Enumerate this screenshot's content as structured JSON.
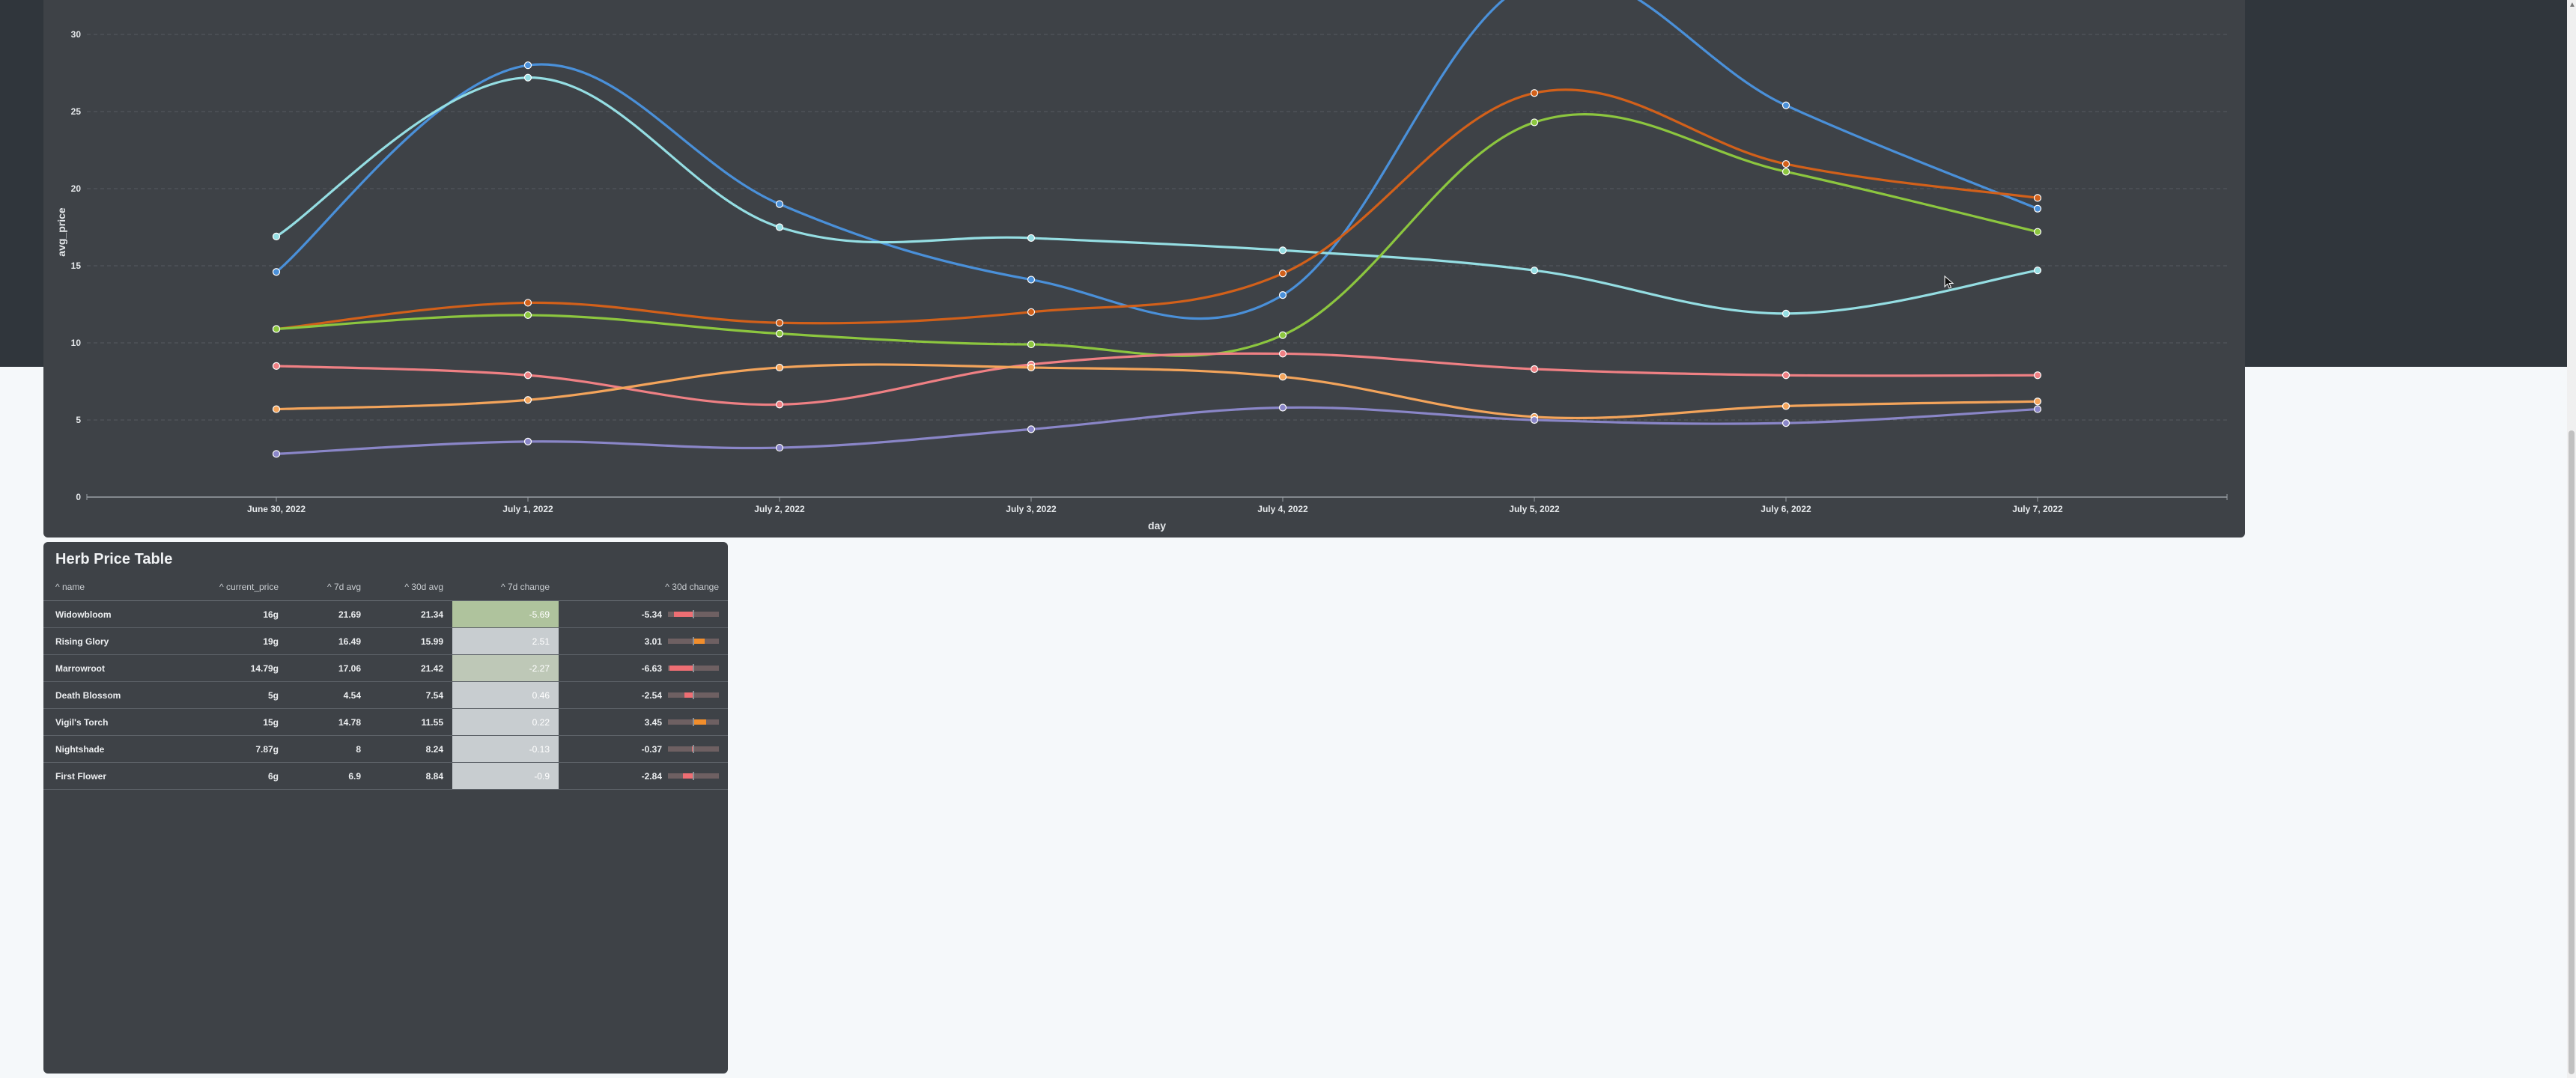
{
  "colors": {
    "background": "#f5f8fa",
    "header_band": "#30363c",
    "panel": "#3e4247",
    "negative_bar": "#ee6e73",
    "positive_bar": "#f28e2c"
  },
  "chart_data": {
    "type": "line",
    "xlabel": "day",
    "ylabel": "avg_price",
    "categories": [
      "June 30, 2022",
      "July 1, 2022",
      "July 2, 2022",
      "July 3, 2022",
      "July 4, 2022",
      "July 5, 2022",
      "July 6, 2022",
      "July 7, 2022"
    ],
    "yticks": [
      "0",
      "5",
      "10",
      "15",
      "20",
      "25",
      "30"
    ],
    "ylim": [
      0,
      30
    ],
    "grid": true,
    "smooth": true,
    "series": [
      {
        "color": "#4a90d9",
        "values": [
          14.6,
          28.0,
          19.0,
          14.1,
          13.1,
          33.5,
          25.4,
          18.7
        ]
      },
      {
        "color": "#95dee3",
        "values": [
          16.9,
          27.2,
          17.5,
          16.8,
          16.0,
          14.7,
          11.9,
          14.7
        ]
      },
      {
        "color": "#d2601a",
        "values": [
          10.9,
          12.6,
          11.3,
          12.0,
          14.5,
          26.2,
          21.6,
          19.4
        ]
      },
      {
        "color": "#8cc63f",
        "values": [
          10.9,
          11.8,
          10.6,
          9.9,
          10.5,
          24.3,
          21.1,
          17.2
        ]
      },
      {
        "color": "#ef8084",
        "values": [
          8.5,
          7.9,
          6.0,
          8.6,
          9.3,
          8.3,
          7.9,
          7.9
        ]
      },
      {
        "color": "#f3a45b",
        "values": [
          5.7,
          6.3,
          8.4,
          8.4,
          7.8,
          5.2,
          5.9,
          6.2
        ]
      },
      {
        "color": "#8a86c8",
        "values": [
          2.8,
          3.6,
          3.2,
          4.4,
          5.8,
          5.0,
          4.8,
          5.7
        ]
      }
    ]
  },
  "table": {
    "title": "Herb Price Table",
    "sort_glyph": "^",
    "columns": [
      "name",
      "current_price",
      "7d avg",
      "30d avg",
      "7d change",
      "30d change"
    ],
    "rows": [
      {
        "name": "Widowbloom",
        "current_price": "16g",
        "avg7": "21.69",
        "avg30": "21.34",
        "chg7": "-5.69",
        "chg30": "-5.34",
        "chg30_value": -5.34
      },
      {
        "name": "Rising Glory",
        "current_price": "19g",
        "avg7": "16.49",
        "avg30": "15.99",
        "chg7": "2.51",
        "chg30": "3.01",
        "chg30_value": 3.01
      },
      {
        "name": "Marrowroot",
        "current_price": "14.79g",
        "avg7": "17.06",
        "avg30": "21.42",
        "chg7": "-2.27",
        "chg30": "-6.63",
        "chg30_value": -6.63
      },
      {
        "name": "Death Blossom",
        "current_price": "5g",
        "avg7": "4.54",
        "avg30": "7.54",
        "chg7": "0.46",
        "chg30": "-2.54",
        "chg30_value": -2.54
      },
      {
        "name": "Vigil's Torch",
        "current_price": "15g",
        "avg7": "14.78",
        "avg30": "11.55",
        "chg7": "0.22",
        "chg30": "3.45",
        "chg30_value": 3.45
      },
      {
        "name": "Nightshade",
        "current_price": "7.87g",
        "avg7": "8",
        "avg30": "8.24",
        "chg7": "-0.13",
        "chg30": "-0.37",
        "chg30_value": -0.37
      },
      {
        "name": "First Flower",
        "current_price": "6g",
        "avg7": "6.9",
        "avg30": "8.84",
        "chg7": "-0.9",
        "chg30": "-2.84",
        "chg30_value": -2.84
      }
    ]
  }
}
